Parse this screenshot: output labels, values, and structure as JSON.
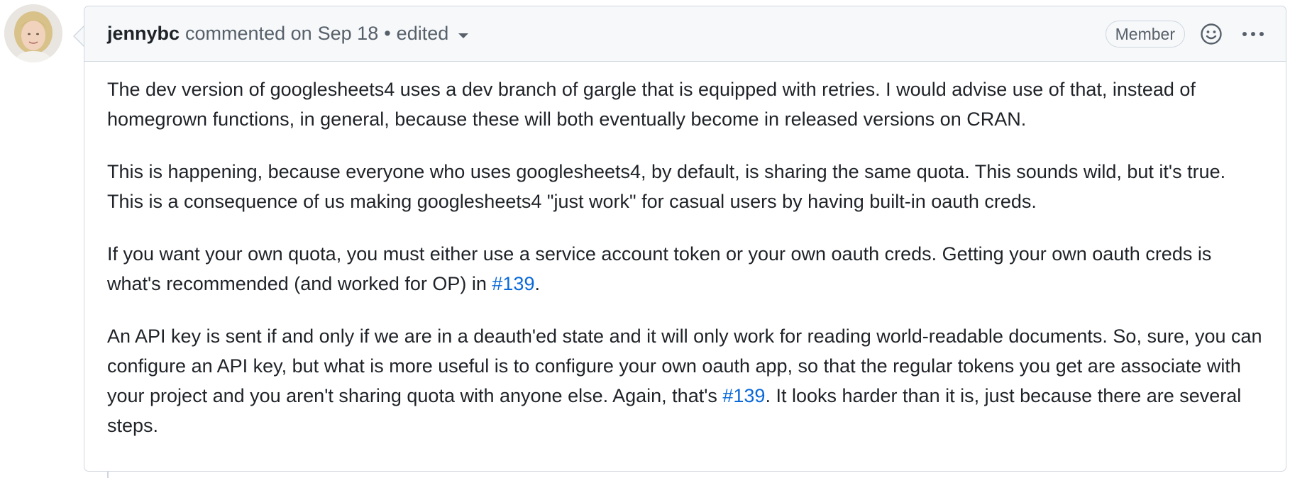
{
  "comment": {
    "author": "jennybc",
    "action": "commented on",
    "date": "Sep 18",
    "separator": "•",
    "edited_label": "edited",
    "role_badge": "Member",
    "icons": {
      "avatar": "user-avatar",
      "reaction": "smiley-icon",
      "menu": "kebab-horizontal-icon",
      "edited_dropdown": "caret-down-icon"
    },
    "paragraphs": [
      {
        "text": "The dev version of googlesheets4 uses a dev branch of gargle that is equipped with retries. I would advise use of that, instead of homegrown functions, in general, because these will both eventually become in released versions on CRAN."
      },
      {
        "text": "This is happening, because everyone who uses googlesheets4, by default, is sharing the same quota. This sounds wild, but it's true. This is a consequence of us making googlesheets4 \"just work\" for casual users by having built-in oauth creds."
      },
      {
        "before": "If you want your own quota, you must either use a service account token or your own oauth creds. Getting your own oauth creds is what's recommended (and worked for OP) in ",
        "link": "#139",
        "after": "."
      },
      {
        "before": "An API key is sent if and only if we are in a deauth'ed state and it will only work for reading world-readable documents. So, sure, you can configure an API key, but what is more useful is to configure your own oauth app, so that the regular tokens you get are associate with your project and you aren't sharing quota with anyone else. Again, that's ",
        "link": "#139",
        "after": ". It looks harder than it is, just because there are several steps."
      }
    ]
  },
  "colors": {
    "link": "#0969da",
    "border": "#d0d7de",
    "header_bg": "#f6f8fa",
    "muted_text": "#57606a",
    "text": "#1f2328"
  }
}
